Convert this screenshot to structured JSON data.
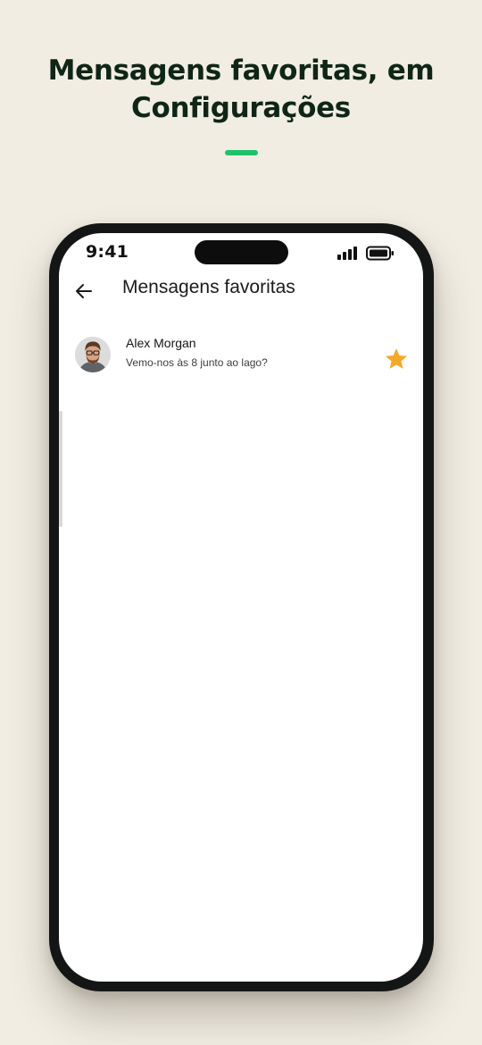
{
  "headline": {
    "line1": "Mensagens favoritas, em",
    "line2": "Configurações"
  },
  "status_bar": {
    "time": "9:41",
    "signal_icon": "cellular-signal-icon",
    "battery_icon": "battery-icon"
  },
  "header": {
    "back_icon": "arrow-left-icon",
    "title": "Mensagens favoritas"
  },
  "messages": [
    {
      "name": "Alex Morgan",
      "text": "Vemo-nos às 8 junto ao lago?",
      "starred": true,
      "star_icon": "star-icon"
    }
  ],
  "colors": {
    "background": "#f1ede3",
    "headline": "#0f2616",
    "accent": "#1fc16b",
    "star": "#f4a827",
    "phone_frame": "#141515"
  }
}
